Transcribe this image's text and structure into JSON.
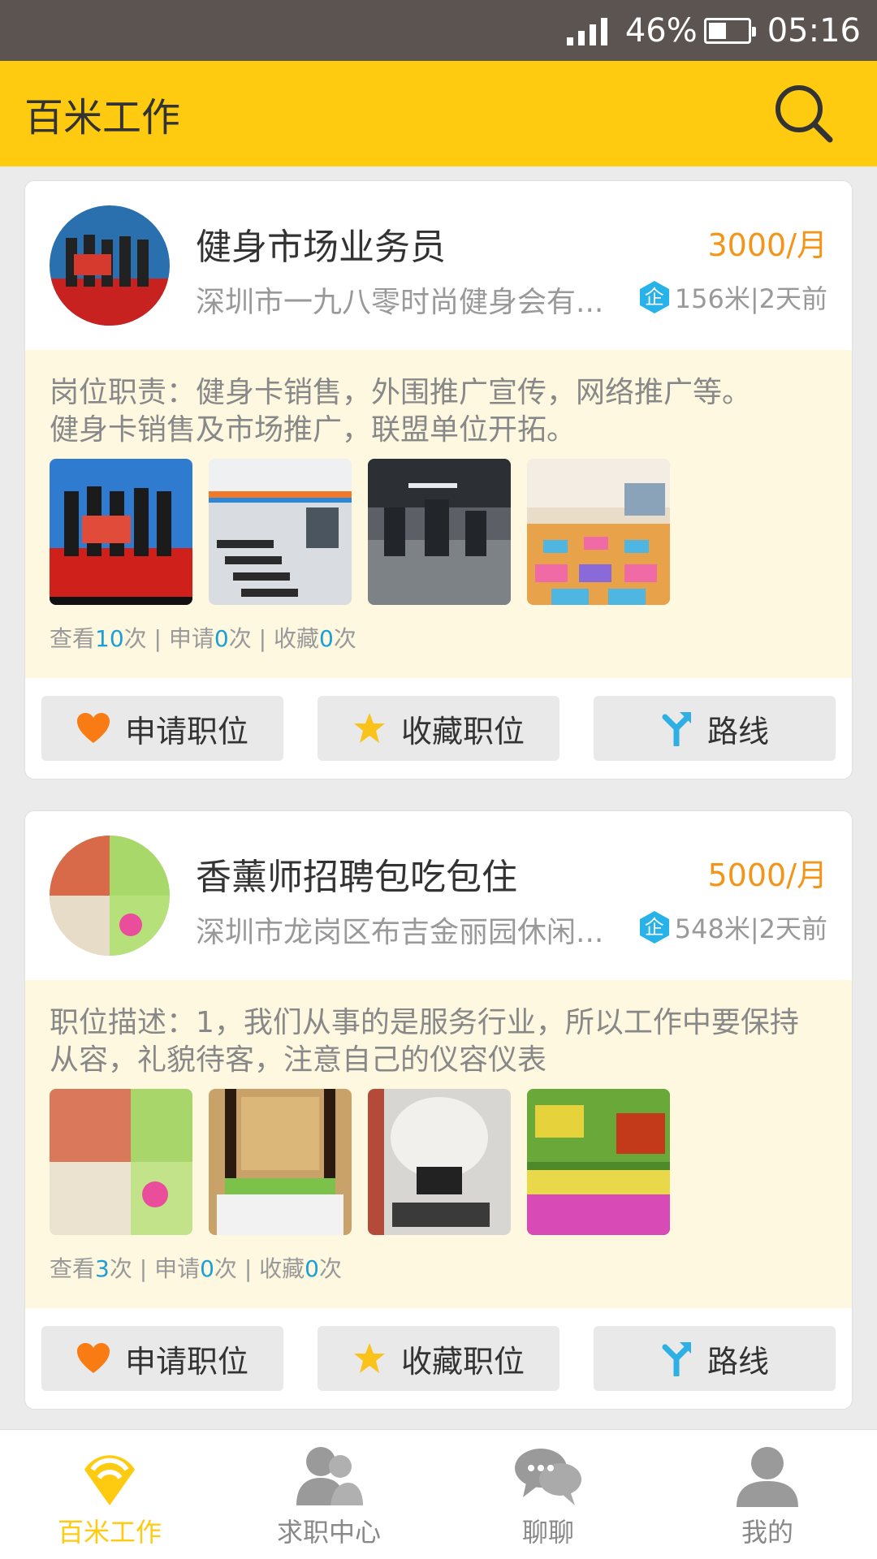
{
  "status_bar": {
    "battery": "46%",
    "time": "05:16"
  },
  "app_bar": {
    "title": "百米工作"
  },
  "jobs": [
    {
      "title": "健身市场业务员",
      "salary": "3000/月",
      "company": "深圳市一九八零时尚健身会有...",
      "badge": "企",
      "distance_time": "156米|2天前",
      "description": "岗位职责：健身卡销售，外围推广宣传，网络推广等。\n健身卡销售及市场推广，联盟单位开拓。",
      "stats": {
        "view_label": "查看",
        "views": "10",
        "apply_label": "次 | 申请",
        "applies": "0",
        "fav_label": "次 | 收藏",
        "favs": "0",
        "end": "次"
      }
    },
    {
      "title": "香薰师招聘包吃包住",
      "salary": "5000/月",
      "company": "深圳市龙岗区布吉金丽园休闲...",
      "badge": "企",
      "distance_time": "548米|2天前",
      "description": "职位描述：1，我们从事的是服务行业，所以工作中要保持从容，礼貌待客，注意自己的仪容仪表",
      "stats": {
        "view_label": "查看",
        "views": "3",
        "apply_label": "次 | 申请",
        "applies": "0",
        "fav_label": "次 | 收藏",
        "favs": "0",
        "end": "次"
      }
    }
  ],
  "actions": {
    "apply": "申请职位",
    "favorite": "收藏职位",
    "route": "路线"
  },
  "bottom_nav": [
    {
      "label": "百米工作",
      "icon": "baimi-icon",
      "active": true
    },
    {
      "label": "求职中心",
      "icon": "users-icon",
      "active": false
    },
    {
      "label": "聊聊",
      "icon": "chat-icon",
      "active": false
    },
    {
      "label": "我的",
      "icon": "person-icon",
      "active": false
    }
  ],
  "colors": {
    "brand": "#fecb10",
    "salary": "#f39519",
    "stat_num": "#1a9fd6",
    "badge": "#27b3e9"
  }
}
